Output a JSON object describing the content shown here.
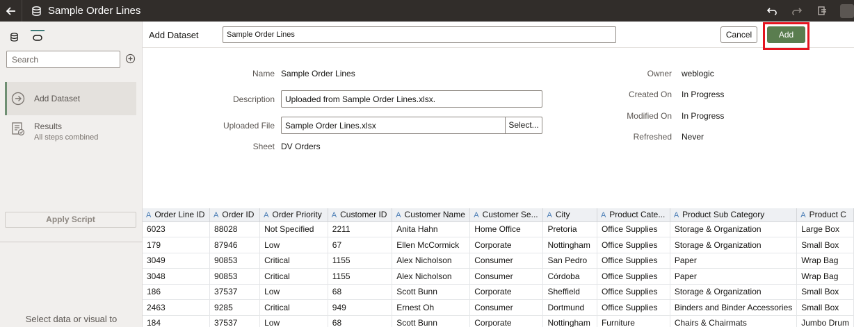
{
  "topbar": {
    "title": "Sample Order Lines",
    "icons": [
      "back-arrow-icon",
      "database-icon",
      "undo-icon",
      "redo-icon",
      "preview-icon"
    ]
  },
  "leftpanel": {
    "search_placeholder": "Search",
    "steps": [
      {
        "label": "Add Dataset",
        "sub": ""
      },
      {
        "label": "Results",
        "sub": "All steps combined"
      }
    ],
    "apply_script": "Apply Script",
    "hint": "Select data or visual to"
  },
  "header": {
    "label": "Add Dataset",
    "name_value": "Sample Order Lines",
    "cancel": "Cancel",
    "add": "Add"
  },
  "details": {
    "name_label": "Name",
    "name_value": "Sample Order Lines",
    "description_label": "Description",
    "description_value": "Uploaded from Sample Order Lines.xlsx.",
    "file_label": "Uploaded File",
    "file_value": "Sample Order Lines.xlsx",
    "select_label": "Select...",
    "sheet_label": "Sheet",
    "sheet_value": "DV Orders",
    "owner_label": "Owner",
    "owner_value": "weblogic",
    "created_label": "Created On",
    "created_value": "In Progress",
    "modified_label": "Modified On",
    "modified_value": "In Progress",
    "refreshed_label": "Refreshed",
    "refreshed_value": "Never"
  },
  "table": {
    "col_type_icon": "A",
    "columns": [
      "Order Line ID",
      "Order ID",
      "Order Priority",
      "Customer ID",
      "Customer Name",
      "Customer Se...",
      "City",
      "Product Cate...",
      "Product Sub Category",
      "Product C"
    ],
    "rows": [
      [
        "6023",
        "88028",
        "Not Specified",
        "2211",
        "Anita Hahn",
        "Home Office",
        "Pretoria",
        "Office Supplies",
        "Storage & Organization",
        "Large Box"
      ],
      [
        "179",
        "87946",
        "Low",
        "67",
        "Ellen McCormick",
        "Corporate",
        "Nottingham",
        "Office Supplies",
        "Storage & Organization",
        "Small Box"
      ],
      [
        "3049",
        "90853",
        "Critical",
        "1155",
        "Alex Nicholson",
        "Consumer",
        "San Pedro",
        "Office Supplies",
        "Paper",
        "Wrap Bag"
      ],
      [
        "3048",
        "90853",
        "Critical",
        "1155",
        "Alex Nicholson",
        "Consumer",
        "Córdoba",
        "Office Supplies",
        "Paper",
        "Wrap Bag"
      ],
      [
        "186",
        "37537",
        "Low",
        "68",
        "Scott Bunn",
        "Corporate",
        "Sheffield",
        "Office Supplies",
        "Storage & Organization",
        "Small Box"
      ],
      [
        "2463",
        "9285",
        "Critical",
        "949",
        "Ernest Oh",
        "Consumer",
        "Dortmund",
        "Office Supplies",
        "Binders and Binder Accessories",
        "Small Box"
      ],
      [
        "184",
        "37537",
        "Low",
        "68",
        "Scott Bunn",
        "Corporate",
        "Nottingham",
        "Furniture",
        "Chairs & Chairmats",
        "Jumbo Drum"
      ]
    ]
  },
  "colors": {
    "topbar": "#312d2a",
    "add_button": "#5a7d4f",
    "highlight": "#e4141f",
    "column_icon": "#4a7db5"
  }
}
